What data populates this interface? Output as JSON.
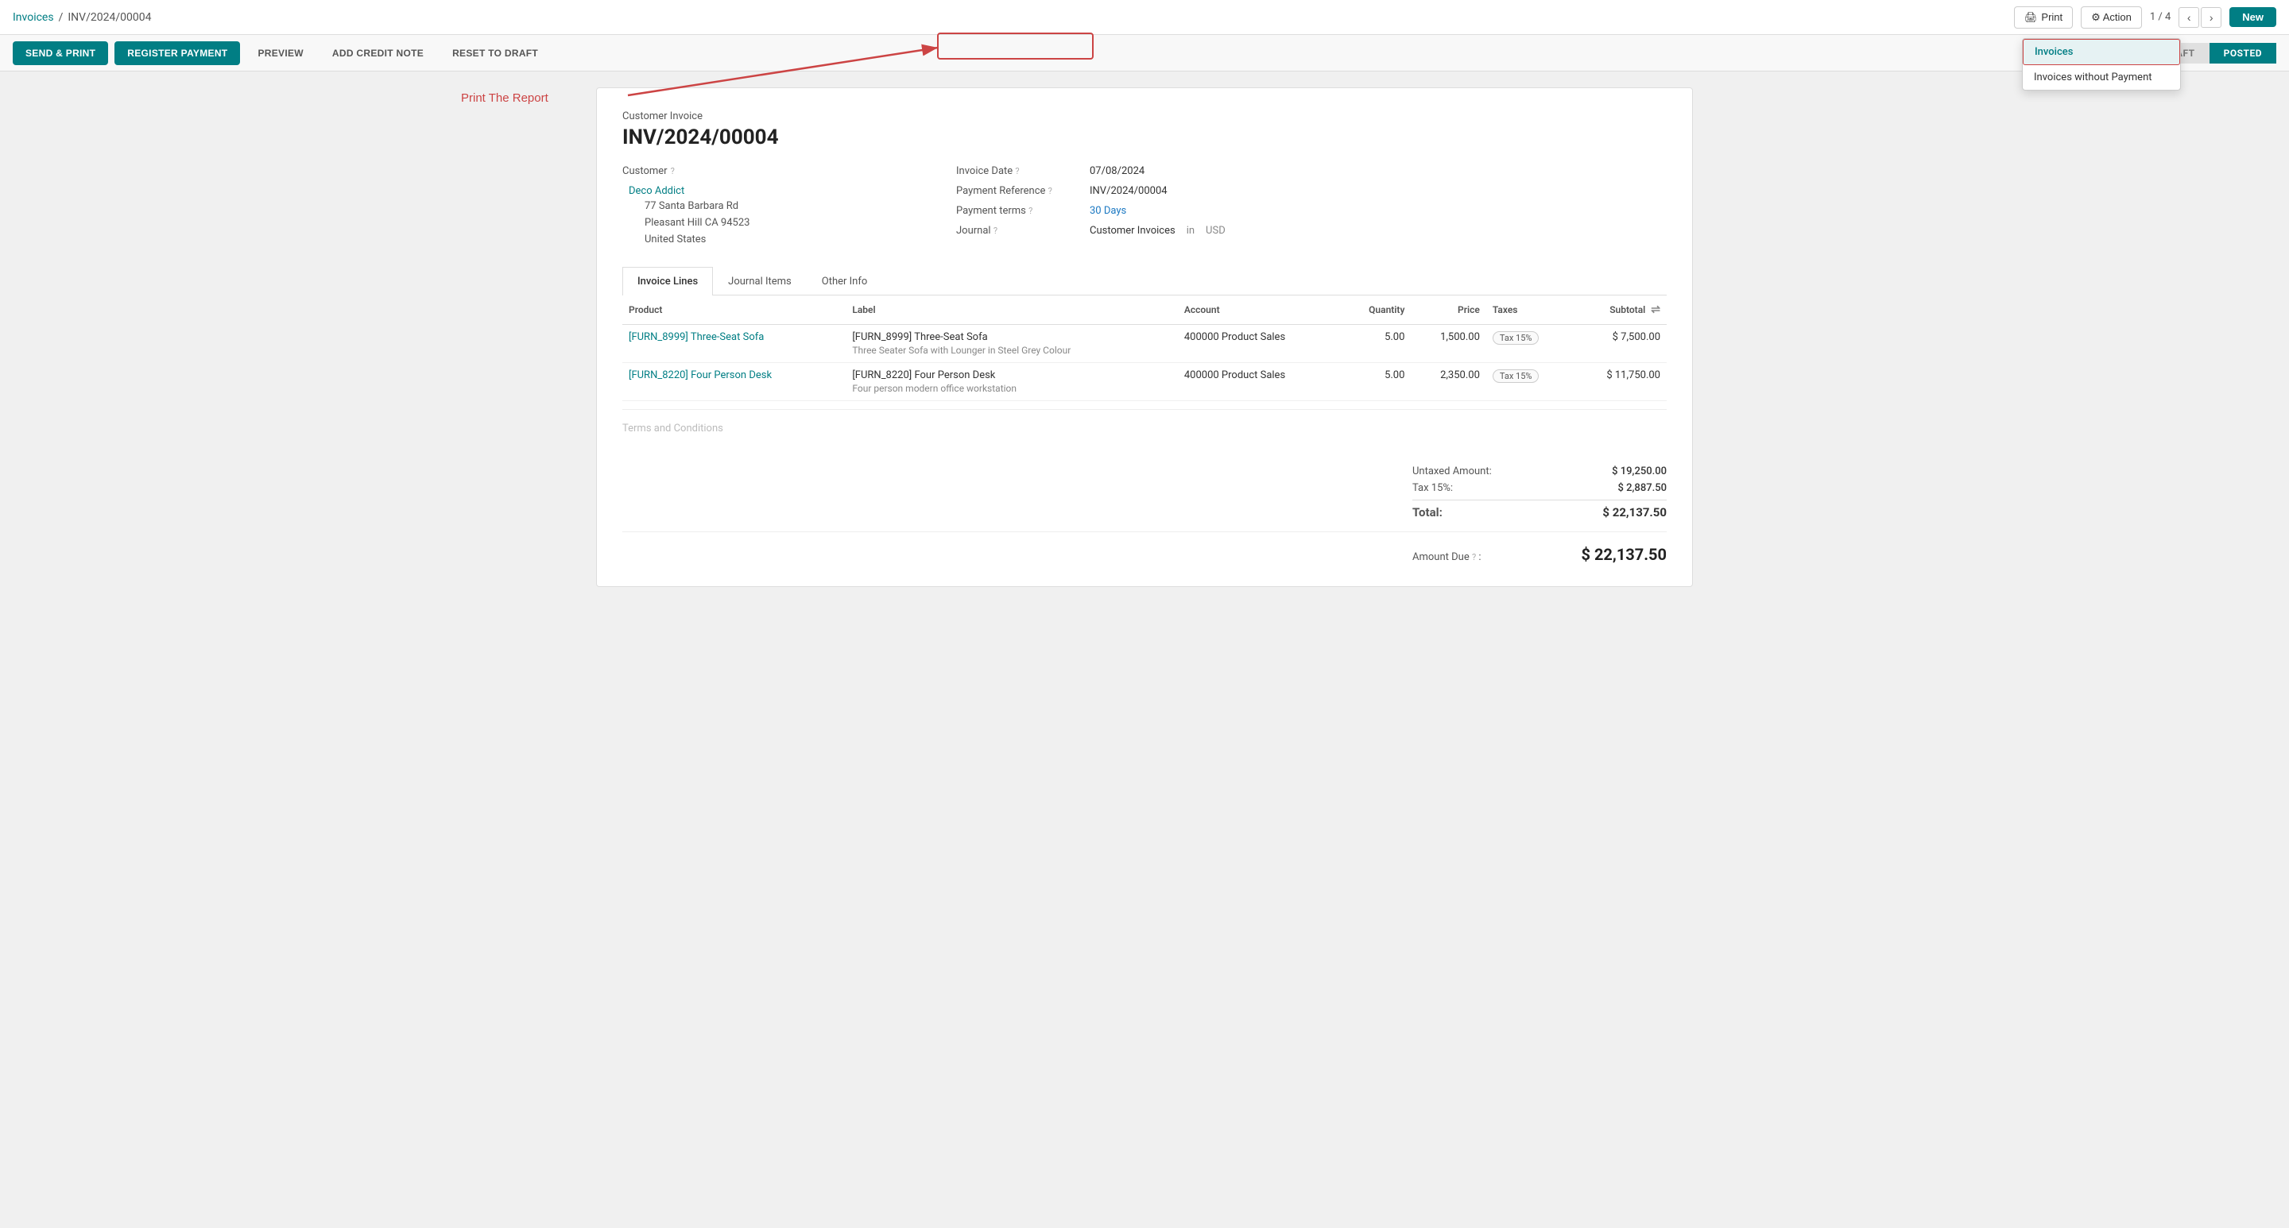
{
  "breadcrumb": {
    "parent": "Invoices",
    "separator": "/",
    "current": "INV/2024/00004"
  },
  "topNav": {
    "print_label": "Print",
    "action_label": "⚙ Action",
    "counter": "1 / 4",
    "new_label": "New"
  },
  "printDropdown": {
    "items": [
      {
        "label": "Invoices",
        "selected": true
      },
      {
        "label": "Invoices without Payment",
        "selected": false
      }
    ]
  },
  "printReportAnnotation": "Print The Report",
  "actionBar": {
    "send_print": "SEND & PRINT",
    "register_payment": "REGISTER PAYMENT",
    "preview": "PREVIEW",
    "add_credit_note": "ADD CREDIT NOTE",
    "reset_to_draft": "RESET TO DRAFT",
    "status_draft": "DRAFT",
    "status_posted": "POSTED"
  },
  "invoice": {
    "type": "Customer Invoice",
    "number": "INV/2024/00004",
    "customer_label": "Customer",
    "customer_name": "Deco Addict",
    "customer_address_line1": "77 Santa Barbara Rd",
    "customer_address_line2": "Pleasant Hill CA 94523",
    "customer_address_line3": "United States",
    "invoice_date_label": "Invoice Date",
    "invoice_date": "07/08/2024",
    "payment_ref_label": "Payment Reference",
    "payment_ref": "INV/2024/00004",
    "payment_terms_label": "Payment terms",
    "payment_terms": "30 Days",
    "journal_label": "Journal",
    "journal_value": "Customer Invoices",
    "journal_in": "in",
    "currency": "USD"
  },
  "tabs": [
    {
      "label": "Invoice Lines",
      "active": true
    },
    {
      "label": "Journal Items",
      "active": false
    },
    {
      "label": "Other Info",
      "active": false
    }
  ],
  "table": {
    "headers": [
      "Product",
      "Label",
      "Account",
      "Quantity",
      "Price",
      "Taxes",
      "Subtotal"
    ],
    "rows": [
      {
        "product": "[FURN_8999] Three-Seat Sofa",
        "label_main": "[FURN_8999] Three-Seat Sofa",
        "label_desc": "Three Seater Sofa with Lounger in Steel Grey Colour",
        "account": "400000 Product Sales",
        "quantity": "5.00",
        "price": "1,500.00",
        "tax": "Tax 15%",
        "subtotal": "$ 7,500.00"
      },
      {
        "product": "[FURN_8220] Four Person Desk",
        "label_main": "[FURN_8220] Four Person Desk",
        "label_desc": "Four person modern office workstation",
        "account": "400000 Product Sales",
        "quantity": "5.00",
        "price": "2,350.00",
        "tax": "Tax 15%",
        "subtotal": "$ 11,750.00"
      }
    ]
  },
  "totals": {
    "untaxed_label": "Untaxed Amount:",
    "untaxed_value": "$ 19,250.00",
    "tax_label": "Tax 15%:",
    "tax_value": "$ 2,887.50",
    "total_label": "Total:",
    "total_value": "$ 22,137.50"
  },
  "amountDue": {
    "label": "Amount Due",
    "value": "$ 22,137.50"
  },
  "termsLabel": "Terms and Conditions"
}
